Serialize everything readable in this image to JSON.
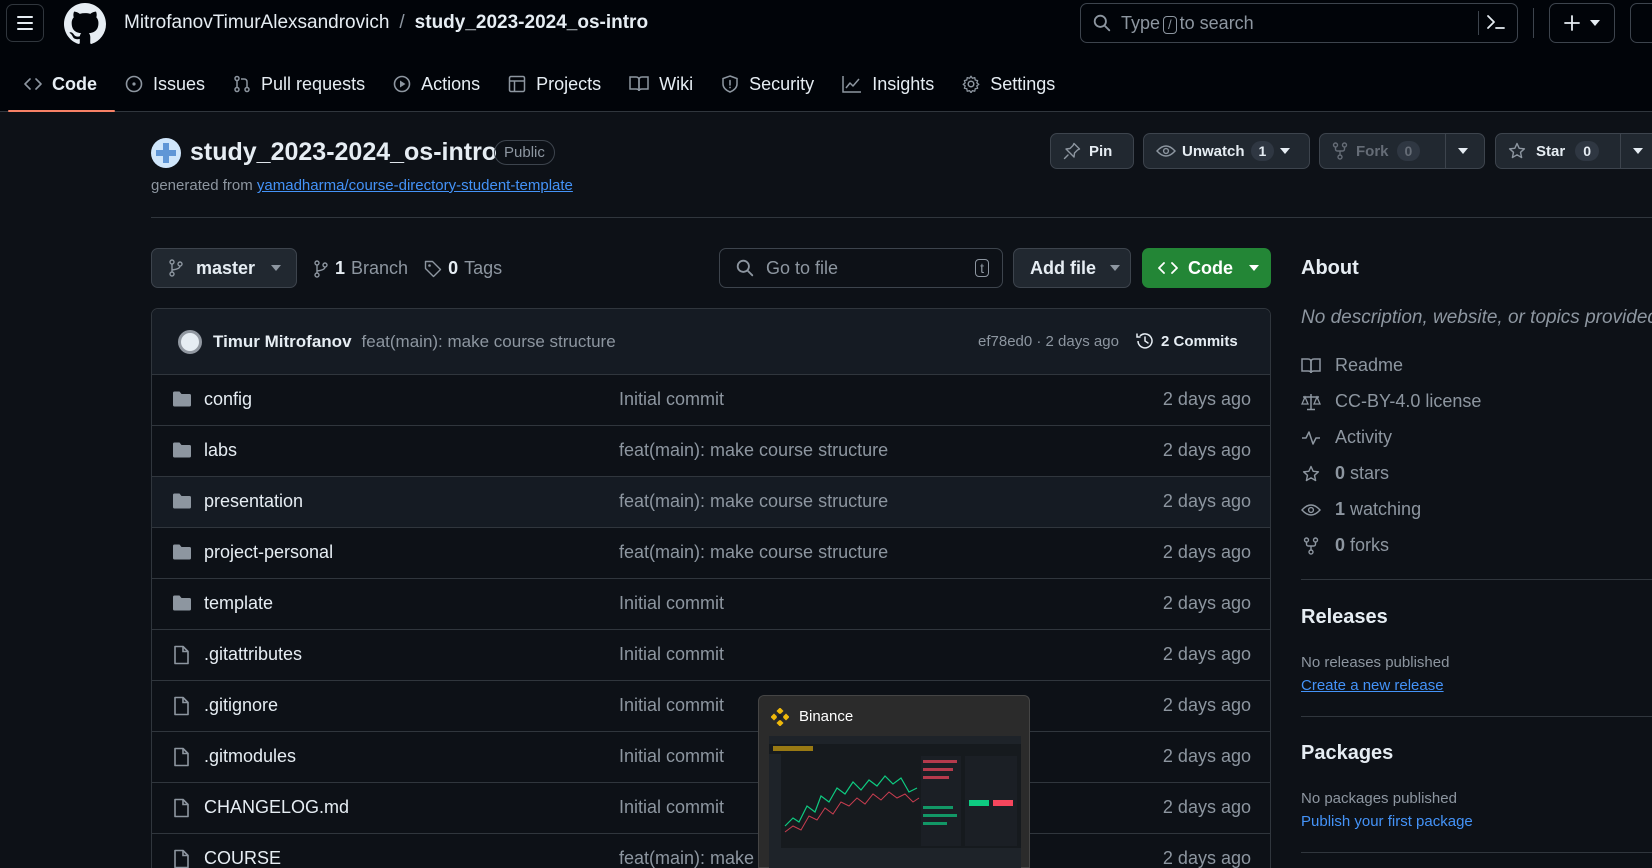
{
  "header": {
    "owner": "MitrofanovTimurAlexsandrovich",
    "separator": "/",
    "repo": "study_2023-2024_os-intro",
    "search_prefix": "Type",
    "search_key": "/",
    "search_suffix": "to search"
  },
  "nav": [
    {
      "label": "Code",
      "icon": "code-icon"
    },
    {
      "label": "Issues",
      "icon": "issue-icon"
    },
    {
      "label": "Pull requests",
      "icon": "pull-request-icon"
    },
    {
      "label": "Actions",
      "icon": "play-icon"
    },
    {
      "label": "Projects",
      "icon": "table-icon"
    },
    {
      "label": "Wiki",
      "icon": "book-icon"
    },
    {
      "label": "Security",
      "icon": "shield-icon"
    },
    {
      "label": "Insights",
      "icon": "graph-icon"
    },
    {
      "label": "Settings",
      "icon": "gear-icon"
    }
  ],
  "repo": {
    "title": "study_2023-2024_os-intro",
    "visibility": "Public",
    "generated_prefix": "generated from",
    "generated_link": "yamadharma/course-directory-student-template",
    "pin": "Pin",
    "unwatch": "Unwatch",
    "watch_count": "1",
    "fork": "Fork",
    "fork_count": "0",
    "star": "Star",
    "star_count": "0"
  },
  "branch": {
    "name": "master",
    "branch_count": "1",
    "branch_label": "Branch",
    "tag_count": "0",
    "tag_label": "Tags",
    "goto_placeholder": "Go to file",
    "goto_key": "t",
    "add_file": "Add file",
    "code": "Code"
  },
  "commit": {
    "author": "Timur Mitrofanov",
    "message": "feat(main): make course structure",
    "meta": "ef78ed0 · 2 days ago",
    "count": "2 Commits"
  },
  "files": [
    {
      "type": "dir",
      "name": "config",
      "message": "Initial commit",
      "date": "2 days ago"
    },
    {
      "type": "dir",
      "name": "labs",
      "message": "feat(main): make course structure",
      "date": "2 days ago"
    },
    {
      "type": "dir",
      "name": "presentation",
      "message": "feat(main): make course structure",
      "date": "2 days ago"
    },
    {
      "type": "dir",
      "name": "project-personal",
      "message": "feat(main): make course structure",
      "date": "2 days ago"
    },
    {
      "type": "dir",
      "name": "template",
      "message": "Initial commit",
      "date": "2 days ago"
    },
    {
      "type": "file",
      "name": ".gitattributes",
      "message": "Initial commit",
      "date": "2 days ago"
    },
    {
      "type": "file",
      "name": ".gitignore",
      "message": "Initial commit",
      "date": "2 days ago"
    },
    {
      "type": "file",
      "name": ".gitmodules",
      "message": "Initial commit",
      "date": "2 days ago"
    },
    {
      "type": "file",
      "name": "CHANGELOG.md",
      "message": "Initial commit",
      "date": "2 days ago"
    },
    {
      "type": "file",
      "name": "COURSE",
      "message": "feat(main): make c",
      "date": "2 days ago"
    }
  ],
  "about": {
    "title": "About",
    "description": "No description, website, or topics provided.",
    "readme": "Readme",
    "license": "CC-BY-4.0 license",
    "activity": "Activity",
    "stars_count": "0",
    "stars_label": "stars",
    "watching_count": "1",
    "watching_label": "watching",
    "forks_count": "0",
    "forks_label": "forks"
  },
  "releases": {
    "title": "Releases",
    "empty": "No releases published",
    "link": "Create a new release"
  },
  "packages": {
    "title": "Packages",
    "empty": "No packages published",
    "link": "Publish your first package"
  },
  "taskbar_preview": {
    "title": "Binance"
  },
  "colors": {
    "background": "#0d1117",
    "header": "#010409",
    "accent_underline": "#f78166",
    "code_button": "#238636",
    "link": "#4493f8",
    "binance": "#f0b90b"
  }
}
